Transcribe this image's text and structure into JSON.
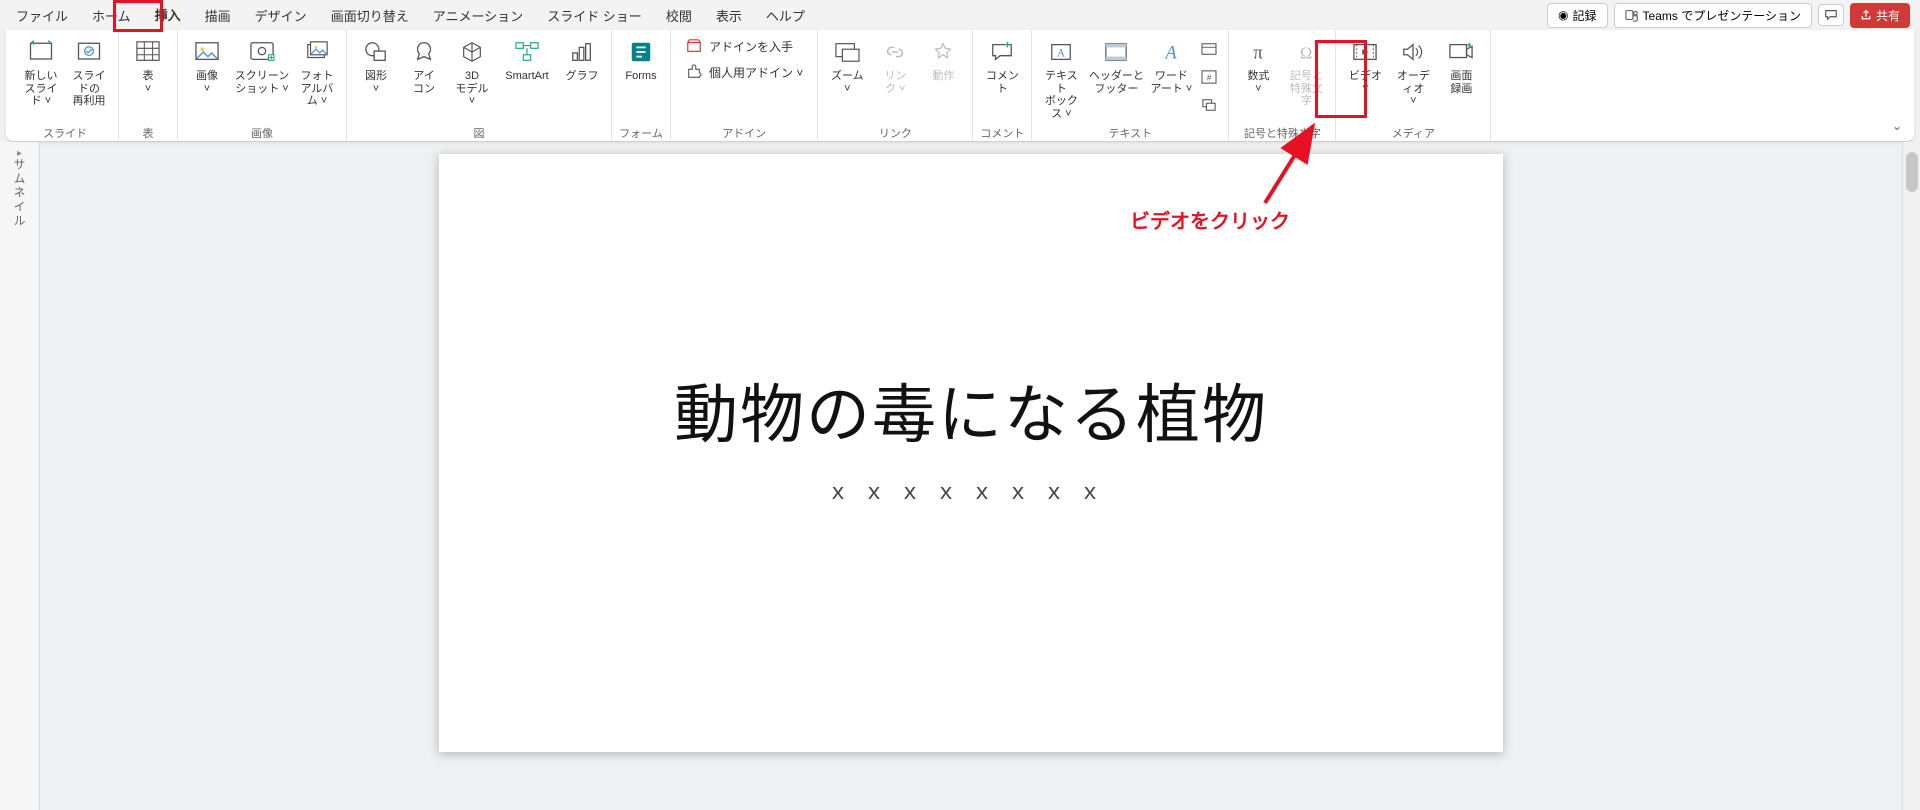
{
  "menu": {
    "tabs": [
      "ファイル",
      "ホーム",
      "挿入",
      "描画",
      "デザイン",
      "画面切り替え",
      "アニメーション",
      "スライド ショー",
      "校閲",
      "表示",
      "ヘルプ"
    ],
    "active_index": 2,
    "record": "記録",
    "teams": "Teams でプレゼンテーション",
    "share": "共有"
  },
  "ribbon": {
    "groups": {
      "slide": {
        "label": "スライド",
        "new_slide": "新しい\nスライド ˅",
        "reuse": "スライドの\n再利用"
      },
      "table": {
        "label": "表",
        "table": "表\n˅"
      },
      "images": {
        "label": "画像",
        "picture": "画像\n˅",
        "screenshot": "スクリーン\nショット ˅",
        "album": "フォト\nアルバム ˅"
      },
      "illustrations": {
        "label": "図",
        "shapes": "図形\n˅",
        "icons": "アイ\nコン",
        "model3d": "3D\nモデル ˅",
        "smartart": "SmartArt",
        "chart": "グラフ"
      },
      "forms": {
        "label": "フォーム",
        "forms": "Forms"
      },
      "addins": {
        "label": "アドイン",
        "get": "アドインを入手",
        "my": "個人用アドイン  ˅"
      },
      "links": {
        "label": "リンク",
        "zoom": "ズーム\n˅",
        "link": "リン\nク ˅",
        "action": "動作"
      },
      "comments": {
        "label": "コメント",
        "comment": "コメント"
      },
      "text": {
        "label": "テキスト",
        "textbox": "テキスト\nボックス ˅",
        "headerfooter": "ヘッダーと\nフッター",
        "wordart": "ワード\nアート ˅"
      },
      "symbols": {
        "label": "記号と特殊文字",
        "equation": "数式\n˅",
        "symbol": "記号と\n特殊文字"
      },
      "media": {
        "label": "メディア",
        "video": "ビデオ\n˅",
        "audio": "オーディオ\n˅",
        "recording": "画面\n録画"
      }
    }
  },
  "thumbnail_label": "サムネイル",
  "slide": {
    "title": "動物の毒になる植物",
    "subtitle": "ｘｘｘｘｘｘｘｘ"
  },
  "annotation": {
    "video_click": "ビデオをクリック"
  }
}
